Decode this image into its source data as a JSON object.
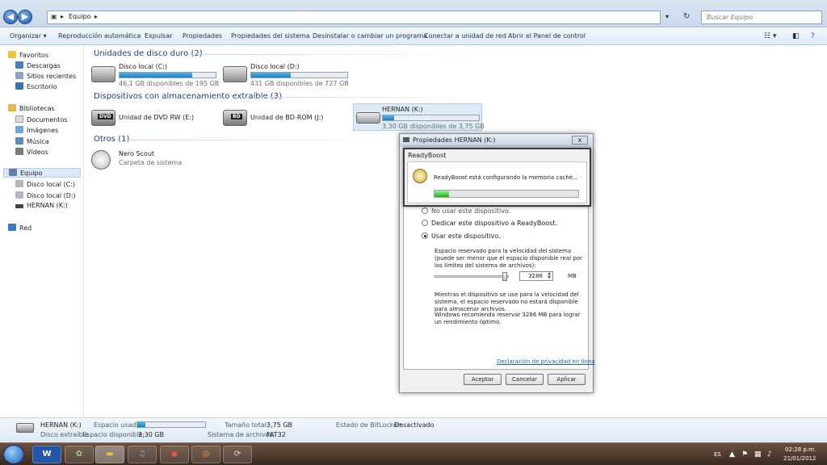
{
  "address": {
    "path_root_icon": "computer-icon",
    "path": "Equipo",
    "search_placeholder": "Buscar Equipo"
  },
  "toolbar": {
    "items": [
      "Organizar",
      "Reproducción automática",
      "Expulsar",
      "Propiedades",
      "Propiedades del sistema",
      "Desinstalar o cambiar un programa",
      "Conectar a unidad de red",
      "Abrir el Panel de control"
    ]
  },
  "sidebar": {
    "favorites": "Favoritos",
    "fav_items": [
      "Descargas",
      "Sitios recientes",
      "Escritorio"
    ],
    "libraries": "Bibliotecas",
    "lib_items": [
      "Documentos",
      "Imágenes",
      "Música",
      "Vídeos"
    ],
    "computer": "Equipo",
    "comp_items": [
      "Disco local (C:)",
      "Disco local (D:)",
      "HERNAN (K:)"
    ],
    "network": "Red"
  },
  "groups": {
    "hdd": "Unidades de disco duro (2)",
    "removable": "Dispositivos con almacenamiento extraíble (3)",
    "others": "Otros (1)"
  },
  "drives": {
    "c": {
      "name": "Disco local (C:)",
      "free": "46,1 GB disponibles de 195 GB",
      "used_fraction": 0.76
    },
    "d": {
      "name": "Disco local (D:)",
      "free": "431 GB disponibles de 727 GB",
      "used_fraction": 0.41
    },
    "dvd": {
      "name": "Unidad de DVD RW (E:)",
      "badge": "DVD"
    },
    "bd": {
      "name": "Unidad de BD-ROM (J:)",
      "badge": "BD"
    },
    "k": {
      "name": "HERNAN (K:)",
      "free": "3,30 GB disponibles de 3,75 GB",
      "used_fraction": 0.12
    },
    "nero": {
      "name": "Nero Scout",
      "type": "Carpeta de sistema"
    }
  },
  "dialog": {
    "title": "Propiedades  HERNAN (K:)",
    "close": "x",
    "radio_no": "No usar este dispositivo.",
    "radio_dedicate": "Dedicar este dispositivo a ReadyBoost.",
    "radio_use": "Usar este dispositivo.",
    "space_text": "Espacio reservado para la velocidad del sistema (puede ser menor que el espacio disponible real por los límites del sistema de archivos):",
    "value": "3286",
    "unit": "MB",
    "note1": "Mientras el dispositivo se use para la velocidad del sistema, el espacio reservado no estará disponible para almacenar archivos.",
    "note2": "Windows recomienda reservar 3286 MB para lograr un rendimiento óptimo.",
    "privacy": "Declaración de privacidad en línea",
    "ok": "Aceptar",
    "cancel": "Cancelar",
    "apply": "Aplicar",
    "slider_fraction": 0.97
  },
  "readyboost": {
    "title": "ReadyBoost",
    "message": "ReadyBoost está configurando la memoria caché...",
    "progress": 0.1
  },
  "details": {
    "name": "HERNAN (K:)",
    "type": "Disco extraíble",
    "used_label": "Espacio usado:",
    "free_label": "Espacio disponible:",
    "free_value": "3,30 GB",
    "total_label": "Tamaño total:",
    "total_value": "3,75 GB",
    "fs_label": "Sistema de archivos:",
    "fs_value": "FAT32",
    "bitlocker_label": "Estado de BitLocker:",
    "bitlocker_value": "Desactivado",
    "used_fraction": 0.12
  },
  "taskbar": {
    "lang": "ES",
    "time": "02:28 p.m.",
    "date": "21/01/2012",
    "word_icon": "W"
  }
}
